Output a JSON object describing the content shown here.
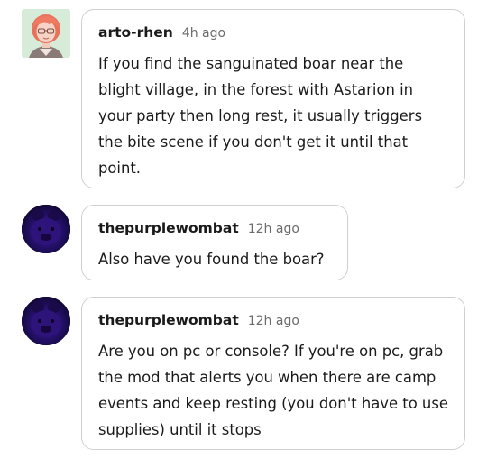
{
  "replies": [
    {
      "username": "arto-rhen",
      "time": "4h ago",
      "text": "If you find the sanguinated boar near the blight village, in the forest with Astarion in your party then long rest, it usually triggers the bite scene if you don't get it until that point.",
      "avatar": "illustrated-redhead-avatar"
    },
    {
      "username": "thepurplewombat",
      "time": "12h ago",
      "text": "Also have you found the boar?",
      "avatar": "purple-wombat-avatar"
    },
    {
      "username": "thepurplewombat",
      "time": "12h ago",
      "text": "Are you on pc or console? If you're on pc, grab the mod that alerts you when there are camp events and keep resting (you don't have to use supplies) until it stops",
      "avatar": "purple-wombat-avatar"
    }
  ],
  "colors": {
    "bubble_border": "#cfcfcf",
    "text": "#1a1a1a",
    "timestamp": "#6b6b6b"
  }
}
